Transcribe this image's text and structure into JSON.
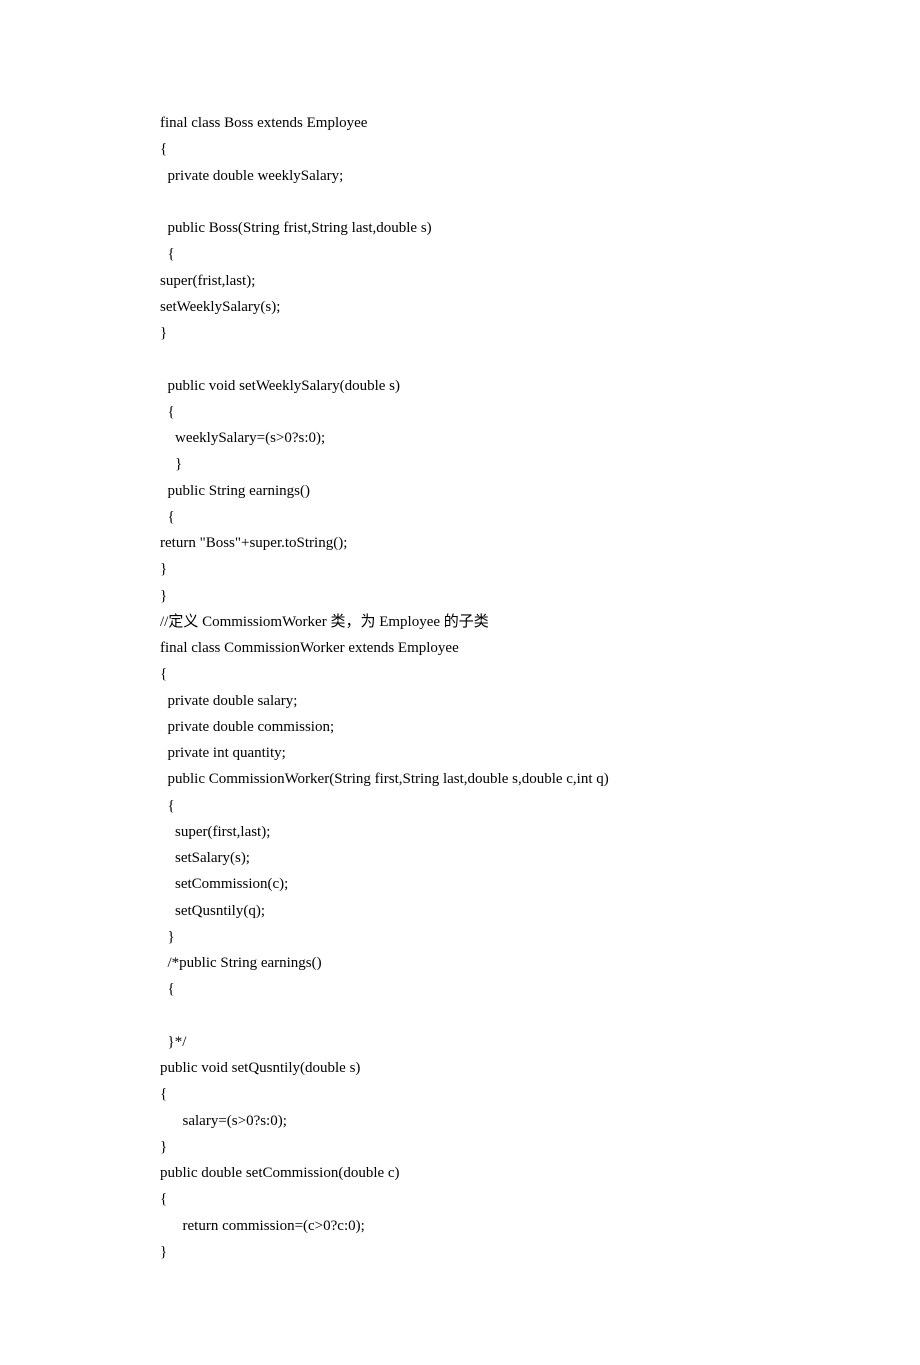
{
  "lines": [
    "final class Boss extends Employee",
    "{",
    "  private double weeklySalary;",
    "",
    "  public Boss(String frist,String last,double s)",
    "  {",
    "super(frist,last);",
    "setWeeklySalary(s);",
    "}",
    "",
    "  public void setWeeklySalary(double s)",
    "  {",
    "    weeklySalary=(s>0?s:0);",
    "    }",
    "  public String earnings()",
    "  {",
    "return \"Boss\"+super.toString();",
    "}",
    "}",
    "//定义 CommissiomWorker 类，为 Employee 的子类",
    "final class CommissionWorker extends Employee",
    "{",
    "  private double salary;",
    "  private double commission;",
    "  private int quantity;",
    "  public CommissionWorker(String first,String last,double s,double c,int q)",
    "  {",
    "    super(first,last);",
    "    setSalary(s);",
    "    setCommission(c);",
    "    setQusntily(q);",
    "  }",
    "  /*public String earnings()",
    "  {",
    "",
    "  }*/",
    "public void setQusntily(double s)",
    "{",
    "      salary=(s>0?s:0);",
    "}",
    "public double setCommission(double c)",
    "{",
    "      return commission=(c>0?c:0);",
    "}"
  ]
}
